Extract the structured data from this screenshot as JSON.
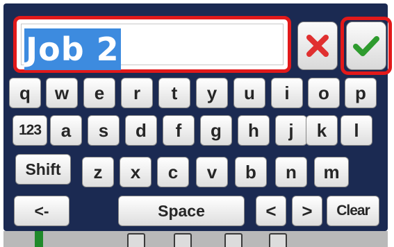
{
  "input": {
    "value": "Job 2"
  },
  "buttons": {
    "cancel_icon": "close-icon",
    "ok_icon": "check-icon"
  },
  "keyboard": {
    "row1": [
      "q",
      "w",
      "e",
      "r",
      "t",
      "y",
      "u",
      "i",
      "o",
      "p"
    ],
    "row2": [
      "123",
      "a",
      "s",
      "d",
      "f",
      "g",
      "h",
      "j",
      "k",
      "l"
    ],
    "row3": [
      "Shift",
      "z",
      "x",
      "c",
      "v",
      "b",
      "n",
      "m"
    ],
    "row4": {
      "backspace": "<-",
      "space": "Space",
      "left": "<",
      "right": ">",
      "clear": "Clear"
    }
  },
  "colors": {
    "panel": "#1b2a52",
    "highlight": "#e2191a",
    "selection": "#3d8bdf",
    "cancel": "#e03030",
    "ok": "#2e9b2e"
  }
}
